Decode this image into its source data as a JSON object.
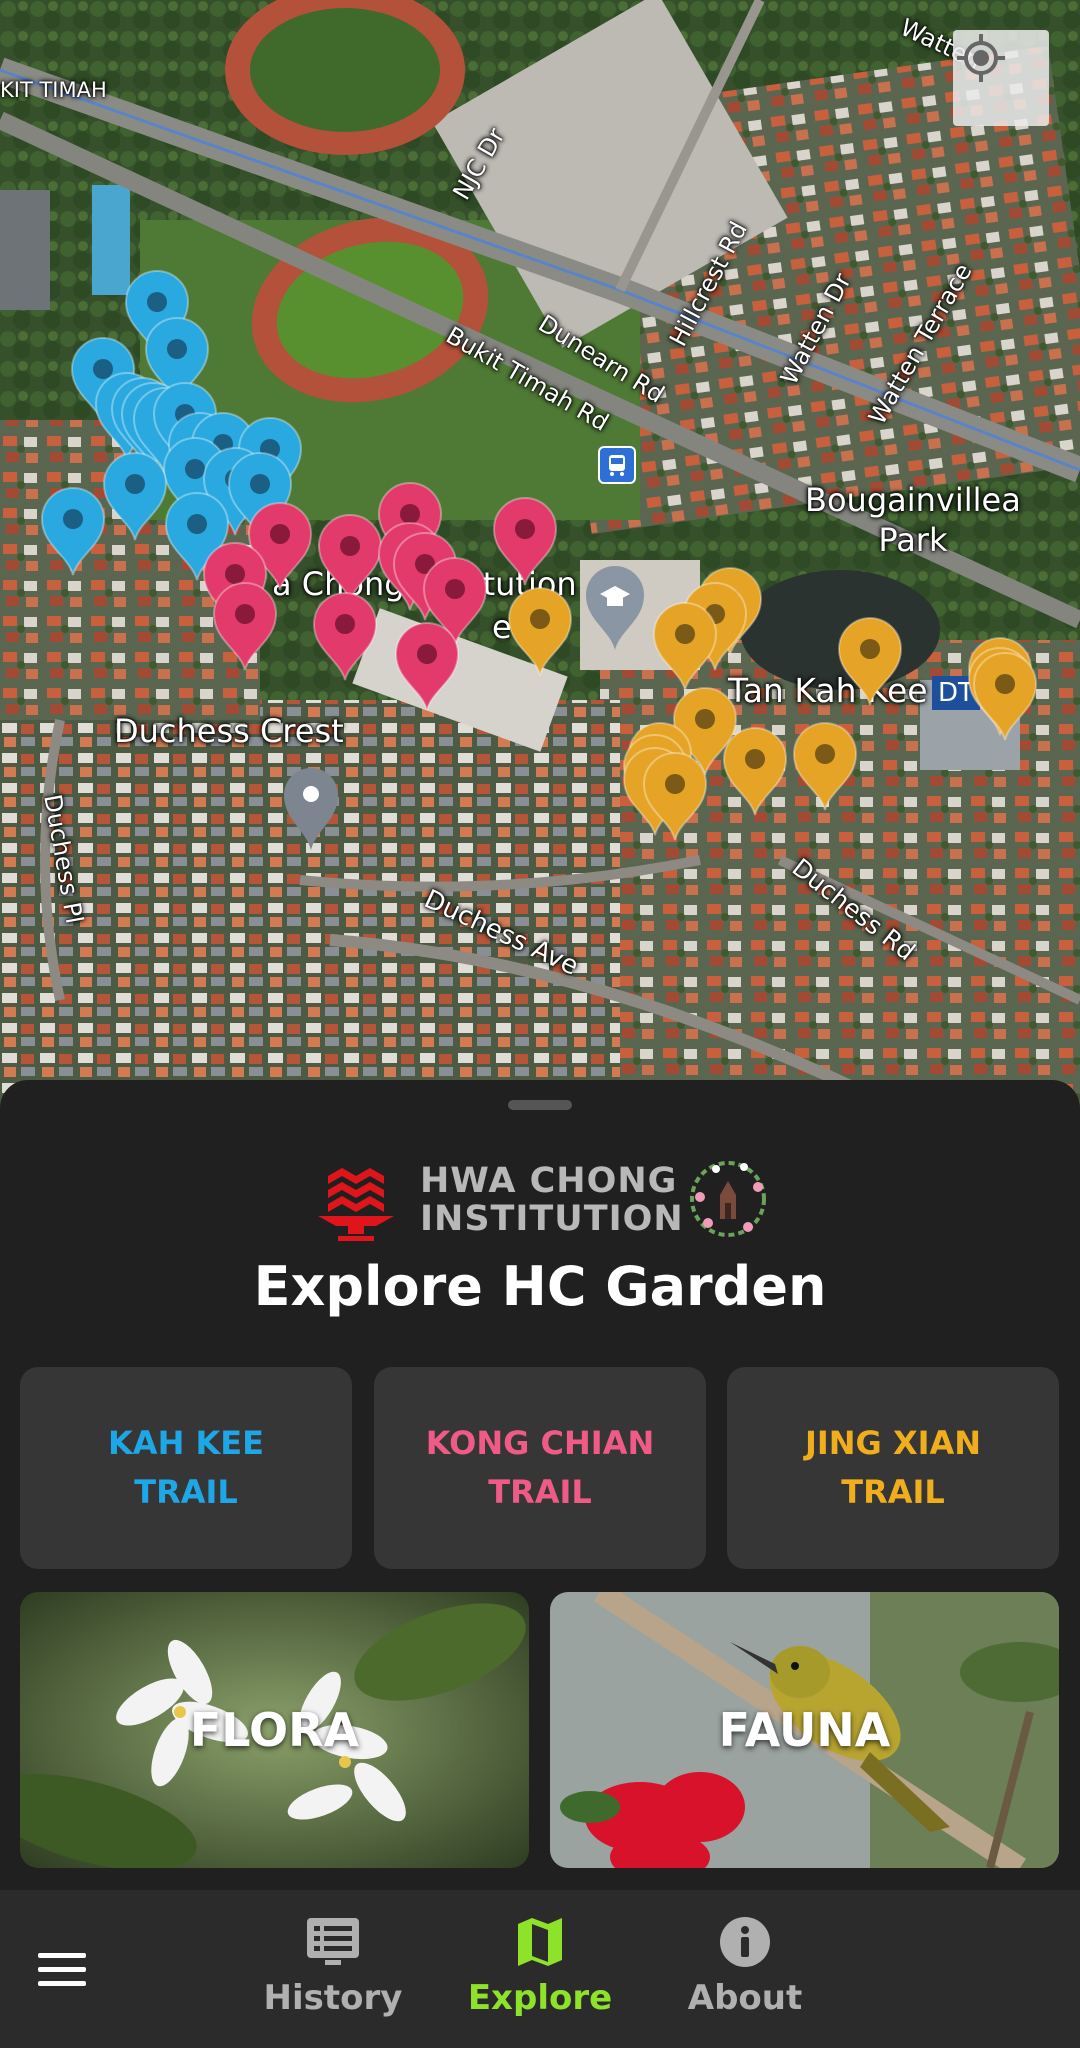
{
  "map": {
    "labels": {
      "bukit_timah_corner": "KIT TIMAH",
      "njc_dr": "NJC Dr",
      "watten_top": "Watten",
      "hillcrest_rd": "Hillcrest Rd",
      "dunearn_rd": "Dunearn Rd",
      "bukit_timah_rd": "Bukit Timah Rd",
      "watten_dr": "Watten Dr",
      "watten_terrace": "Watten Terrace",
      "bougainvillea_park": "Bougainvillea\nPark",
      "hwa_chong_partial": "a Chong Institution",
      "secondary_partial": "ec",
      "tan_kah_kee": "Tan Kah Kee",
      "duchess_crest": "Duchess Crest",
      "duchess_pl": "Duchess Pl",
      "duchess_ave": "Duchess Ave",
      "duchess_rd": "Duchess Rd",
      "dt_badge": "DT"
    },
    "locate_button_icon": "my-location-icon",
    "marker_colors": {
      "kah_kee": "#2aa9e0",
      "kong_chian": "#e23a6a",
      "jing_xian": "#e6a426",
      "school": "#8a96a3",
      "place": "#7d8690"
    }
  },
  "sheet": {
    "logo_text": "HWA CHONG\nINSTITUTION",
    "title": "Explore HC Garden",
    "trails": [
      {
        "label": "KAH KEE\nTRAIL",
        "color": "#1ea7e6"
      },
      {
        "label": "KONG CHIAN\nTRAIL",
        "color": "#ef5b86"
      },
      {
        "label": "JING XIAN\nTRAIL",
        "color": "#f0ae1c"
      }
    ],
    "categories": {
      "flora": "FLORA",
      "fauna": "FAUNA"
    }
  },
  "nav": {
    "menu_icon": "hamburger-menu-icon",
    "items": [
      {
        "label": "History",
        "icon": "history-list-icon",
        "color": "#b0b0b0"
      },
      {
        "label": "Explore",
        "icon": "map-icon",
        "color": "#8ee22a"
      },
      {
        "label": "About",
        "icon": "info-icon",
        "color": "#b0b0b0"
      }
    ]
  }
}
